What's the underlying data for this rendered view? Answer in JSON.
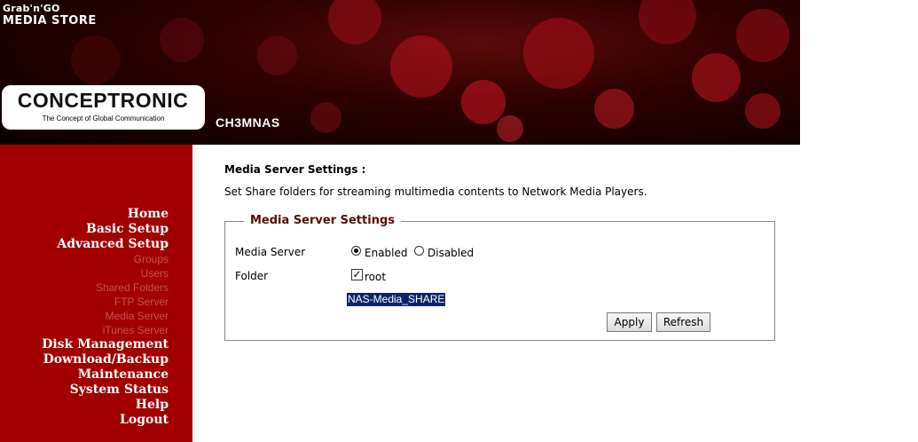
{
  "header": {
    "store_line1": "Grab'n'GO",
    "store_line2": "MEDIA STORE",
    "brand": "CONCEPTRONIC",
    "brand_tagline": "The Concept of Global Communication",
    "model": "CH3MNAS"
  },
  "sidebar": {
    "items": [
      {
        "label": "Home",
        "type": "main"
      },
      {
        "label": "Basic Setup",
        "type": "main"
      },
      {
        "label": "Advanced Setup",
        "type": "main"
      },
      {
        "label": "Groups",
        "type": "sub"
      },
      {
        "label": "Users",
        "type": "sub"
      },
      {
        "label": "Shared Folders",
        "type": "sub"
      },
      {
        "label": "FTP Server",
        "type": "sub"
      },
      {
        "label": "Media Server",
        "type": "sub"
      },
      {
        "label": "iTunes Server",
        "type": "sub"
      },
      {
        "label": "Disk Management",
        "type": "main"
      },
      {
        "label": "Download/Backup",
        "type": "main"
      },
      {
        "label": "Maintenance",
        "type": "main"
      },
      {
        "label": "System Status",
        "type": "main"
      },
      {
        "label": "Help",
        "type": "main"
      },
      {
        "label": "Logout",
        "type": "main"
      }
    ]
  },
  "main": {
    "title": "Media Server Settings :",
    "description": "Set Share folders for streaming multimedia contents to Network Media Players.",
    "box": {
      "legend": "Media Server Settings",
      "media_server_label": "Media Server",
      "enabled_label": "Enabled",
      "disabled_label": "Disabled",
      "selected": "Enabled",
      "folder_label": "Folder",
      "folder_option": "root",
      "folder_checked": true,
      "share_name": "NAS-Media_SHARE",
      "apply_label": "Apply",
      "refresh_label": "Refresh"
    }
  },
  "colors": {
    "sidebar_bg": "#a20000",
    "sub_item_text": "#c85050",
    "legend_text": "#5a0a0a",
    "selection_bg": "#0a246a"
  }
}
